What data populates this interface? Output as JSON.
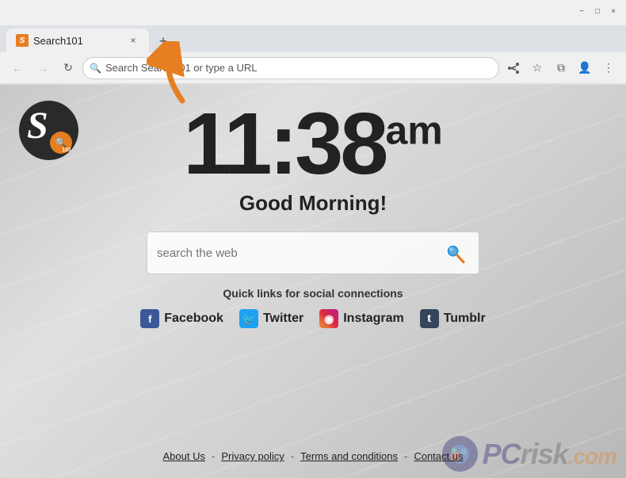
{
  "browser": {
    "tab": {
      "title": "Search101",
      "favicon_label": "S"
    },
    "new_tab_label": "+",
    "address_bar": {
      "placeholder": "Search Search101 or type a URL",
      "value": ""
    },
    "window_controls": {
      "minimize": "−",
      "maximize": "□",
      "close": "×"
    }
  },
  "page": {
    "clock": {
      "time": "11:38",
      "ampm": "am"
    },
    "greeting": "Good Morning!",
    "search": {
      "placeholder": "search the web",
      "button_label": "🔍"
    },
    "quick_links_label": "Quick links for social connections",
    "social_links": [
      {
        "name": "Facebook",
        "icon": "f",
        "type": "facebook"
      },
      {
        "name": "Twitter",
        "icon": "🐦",
        "type": "twitter"
      },
      {
        "name": "Instagram",
        "icon": "◉",
        "type": "instagram"
      },
      {
        "name": "Tumblr",
        "icon": "t",
        "type": "tumblr"
      }
    ],
    "footer": {
      "links": [
        {
          "label": "About Us"
        },
        {
          "sep": "-"
        },
        {
          "label": "Privacy policy"
        },
        {
          "sep": "-"
        },
        {
          "label": "Terms and conditions"
        },
        {
          "sep": "-"
        },
        {
          "label": "Contact us"
        }
      ]
    },
    "watermark": {
      "text": "PC",
      "risk": "risk",
      "com": ".com"
    }
  }
}
